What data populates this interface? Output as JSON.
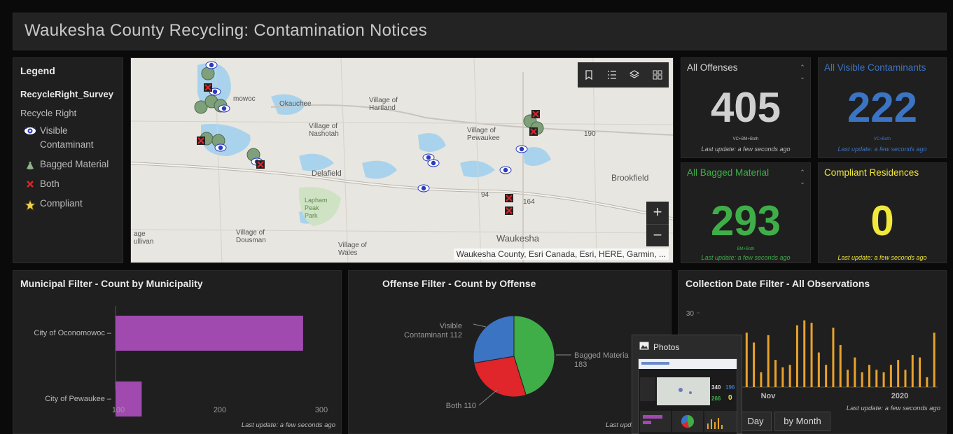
{
  "header": {
    "title": "Waukesha County Recycling: Contamination Notices"
  },
  "legend": {
    "heading": "Legend",
    "layer": "RecycleRight_Survey",
    "group": "Recycle Right",
    "items": [
      {
        "label": "Visible Contaminant",
        "icon": "eye-icon"
      },
      {
        "label": "Bagged Material",
        "icon": "bag-icon"
      },
      {
        "label": "Both",
        "icon": "x-mark-icon"
      },
      {
        "label": "Compliant",
        "icon": "star-icon"
      }
    ]
  },
  "map": {
    "attribution": "Waukesha County, Esri Canada, Esri, HERE, Garmin, ...",
    "zoom_in": "+",
    "zoom_out": "−",
    "labels": [
      "mowoc",
      "Okauchee",
      "Village of Hartland",
      "Village of Nashotah",
      "Village of Pewaukee",
      "190",
      "Delafield",
      "Brookfield",
      "Lapham Peak Park",
      "Village of Dousman",
      "age",
      "ullivan",
      "Village of Wales",
      "Waukesha",
      "94",
      "164"
    ]
  },
  "indicators": {
    "all_offenses": {
      "label": "All Offenses",
      "value": "405",
      "sub": "VC+BM+Both",
      "update": "Last update: a few seconds ago",
      "color": "#d0d0d0"
    },
    "visible": {
      "label": "All Visible Contaminants",
      "value": "222",
      "sub": "VC+Both",
      "update": "Last update: a few seconds ago",
      "color": "#3c74c4"
    },
    "bagged": {
      "label": "All Bagged Material",
      "value": "293",
      "sub": "BM+Both",
      "update": "Last update: a few seconds ago",
      "color": "#3fae49"
    },
    "compliant": {
      "label": "Compliant Residences",
      "value": "0",
      "update": "Last update: a few seconds ago",
      "color": "#f0e83a"
    }
  },
  "municipal": {
    "title": "Municipal Filter - Count by Municipality",
    "update": "Last update: a few seconds ago",
    "chart_data": {
      "type": "bar",
      "orientation": "horizontal",
      "categories": [
        "City of Oconomowoc",
        "City of Pewaukee"
      ],
      "values": [
        282,
        123
      ],
      "xticks": [
        "100",
        "200",
        "300"
      ],
      "xlim": [
        100,
        300
      ],
      "color": "#a04ab0"
    }
  },
  "offense": {
    "title": "Offense Filter - Count by Offense",
    "update": "Last update: a few s",
    "chart_data": {
      "type": "pie",
      "slices": [
        {
          "label": "Bagged Materia",
          "value": 183,
          "color": "#3fae49"
        },
        {
          "label": "Both",
          "value": 110,
          "color": "#e0252b"
        },
        {
          "label": "Visible Contaminant",
          "value": 112,
          "color": "#3c74c4"
        }
      ]
    }
  },
  "collection": {
    "title": "Collection Date Filter - All Observations",
    "update": "Last update: a few seconds ago",
    "yticks": [
      "30"
    ],
    "xlabels": [
      "Nov",
      "2020"
    ],
    "buttons": [
      "Day",
      "by Month"
    ],
    "chart_data": {
      "type": "bar",
      "ylim": [
        0,
        30
      ],
      "values": [
        8,
        6,
        14,
        11,
        7,
        4,
        22,
        18,
        6,
        21,
        11,
        8,
        9,
        25,
        27,
        26,
        14,
        9,
        24,
        17,
        7,
        12,
        6,
        9,
        7,
        6,
        9,
        11,
        7,
        13,
        12,
        4,
        22
      ],
      "color": "#e8a22c"
    }
  },
  "photos": {
    "title": "Photos",
    "thumb_nums": [
      "340",
      "196",
      "266",
      "0"
    ]
  }
}
